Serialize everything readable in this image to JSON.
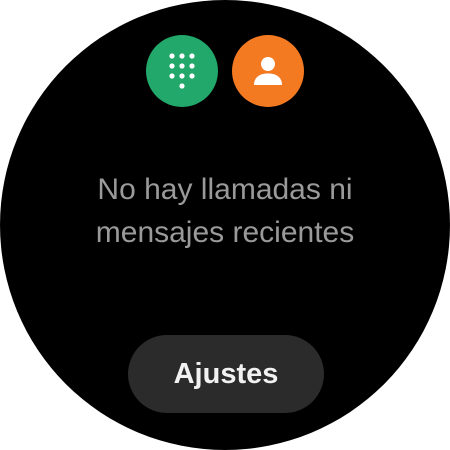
{
  "colors": {
    "background": "#000000",
    "dialpad_button": "#22a86a",
    "contacts_button": "#f47a22",
    "message_text": "#9a9a9a",
    "settings_button": "#2b2b2b",
    "settings_text": "#f2f2f2"
  },
  "top_actions": [
    {
      "icon": "dialpad-icon"
    },
    {
      "icon": "contact-person-icon"
    }
  ],
  "empty_state": {
    "line1": "No hay llamadas ni",
    "line2": "mensajes recientes"
  },
  "settings_button": {
    "label": "Ajustes"
  }
}
